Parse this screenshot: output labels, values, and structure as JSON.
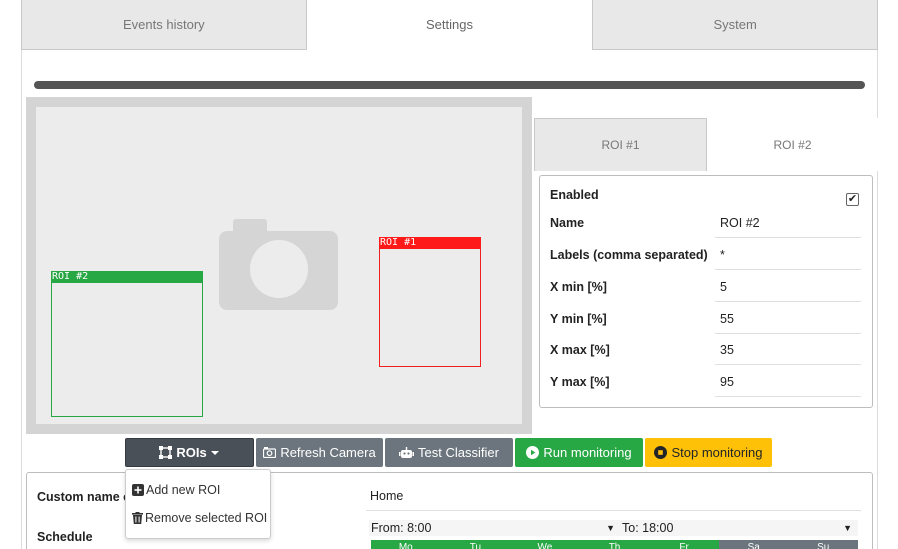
{
  "tabs": [
    {
      "label": "Events history",
      "active": false
    },
    {
      "label": "Settings",
      "active": true
    },
    {
      "label": "System",
      "active": false
    }
  ],
  "preview": {
    "rois": [
      {
        "label": "ROI #1",
        "color": "#ff1a1a"
      },
      {
        "label": "ROI #2",
        "color": "#28a745"
      }
    ]
  },
  "roi_tabs": [
    {
      "label": "ROI #1",
      "active": false
    },
    {
      "label": "ROI #2",
      "active": true
    }
  ],
  "roi_form": {
    "enabled_label": "Enabled",
    "enabled": true,
    "enabled_mark": "✔",
    "name_label": "Name",
    "name_value": "ROI #2",
    "labels_label": "Labels (comma separated)",
    "labels_value": "*",
    "xmin_label": "X min [%]",
    "xmin_value": "5",
    "ymin_label": "Y min [%]",
    "ymin_value": "55",
    "xmax_label": "X max [%]",
    "xmax_value": "35",
    "ymax_label": "Y max [%]",
    "ymax_value": "95"
  },
  "toolbar": {
    "rois_label": "ROIs",
    "refresh_label": "Refresh Camera",
    "test_label": "Test Classifier",
    "run_label": "Run monitoring",
    "stop_label": "Stop monitoring"
  },
  "dropdown": {
    "add_label": "Add new ROI",
    "remove_label": "Remove selected ROI"
  },
  "settings": {
    "custom_name_label": "Custom name o",
    "custom_name_value": "Home",
    "schedule_label": "Schedule",
    "from_label": "From: 8:00",
    "to_label": "To: 18:00",
    "days": [
      {
        "label": "Mo",
        "on": true
      },
      {
        "label": "Tu",
        "on": true
      },
      {
        "label": "We",
        "on": true
      },
      {
        "label": "Th",
        "on": true
      },
      {
        "label": "Fr",
        "on": true
      },
      {
        "label": "Sa",
        "on": false
      },
      {
        "label": "Su",
        "on": false
      }
    ]
  },
  "colors": {
    "success": "#28a745",
    "warning": "#ffc107",
    "secondary": "#6c757d",
    "danger": "#ff1a1a",
    "dark": "#4a5057"
  }
}
